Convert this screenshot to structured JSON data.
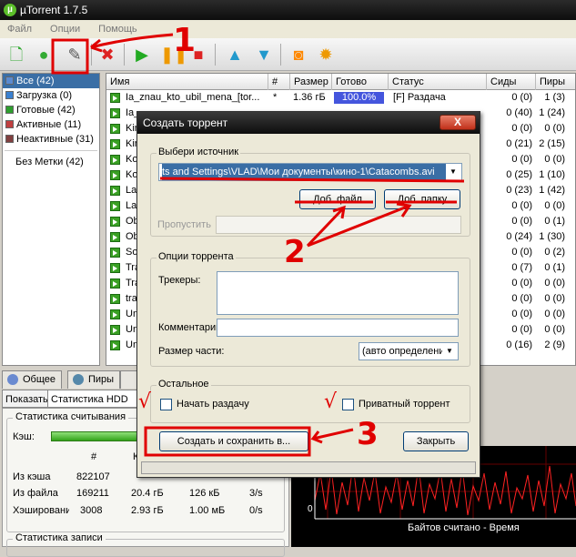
{
  "app": {
    "title": "µTorrent 1.7.5",
    "logo": "µ"
  },
  "menu": [
    "Файл",
    "Опции",
    "Помощь"
  ],
  "toolbar": [
    "add-torrent-icon",
    "add-url-icon",
    "create-torrent-icon",
    "remove-icon",
    "start-icon",
    "pause-icon",
    "stop-icon",
    "move-up-icon",
    "move-down-icon",
    "rss-icon",
    "settings-icon"
  ],
  "sidebar": {
    "items": [
      {
        "label": "Все (42)",
        "color": "#3a6ea5"
      },
      {
        "label": "Загрузка (0)",
        "color": "#3a80d0"
      },
      {
        "label": "Готовые (42)",
        "color": "#2e9e2e"
      },
      {
        "label": "Активные (11)",
        "color": "#c04040"
      },
      {
        "label": "Неактивные (31)",
        "color": "#804040"
      }
    ],
    "nolabel": "Без Метки (42)"
  },
  "list": {
    "columns": [
      "Имя",
      "#",
      "Размер",
      "Готово",
      "Статус",
      "Сиды",
      "Пиры"
    ],
    "first": {
      "name": "Ia_znau_kto_ubil_mena_[tor...",
      "num": "*",
      "size": "1.36 гБ",
      "done": "100.0%",
      "status": "[F] Раздача",
      "seeds": "0 (0)",
      "peers": "1 (3)"
    },
    "names": [
      "Ia_",
      "Kin",
      "Kin",
      "Kor",
      "Kor",
      "Lav",
      "Lav",
      "Ob",
      "Ob",
      "Sor",
      "Tra",
      "Tra",
      "tra",
      "Un",
      "Und",
      "Und"
    ],
    "seeds": [
      "0 (40)",
      "0 (0)",
      "0 (21)",
      "0 (0)",
      "0 (25)",
      "0 (23)",
      "0 (0)",
      "0 (0)",
      "0 (24)",
      "0 (0)",
      "0 (7)",
      "0 (0)",
      "0 (0)",
      "0 (0)",
      "0 (0)",
      "0 (16)"
    ],
    "peers": [
      "1 (24)",
      "0 (0)",
      "2 (15)",
      "0 (0)",
      "1 (10)",
      "1 (42)",
      "0 (0)",
      "0 (1)",
      "1 (30)",
      "0 (2)",
      "0 (1)",
      "0 (0)",
      "0 (0)",
      "0 (0)",
      "0 (0)",
      "2 (9)"
    ]
  },
  "bottom_tabs": [
    "Общее",
    "Пиры"
  ],
  "sub_tabs": [
    "Показать",
    "Статистика HDD"
  ],
  "stats": {
    "read_title": "Статистика считывания",
    "cache_label": "Кэш:",
    "col_hash": "#",
    "col_k": "К",
    "rows": [
      {
        "label": "Из кэша",
        "num": "822107"
      },
      {
        "label": "Из файла",
        "num": "169211",
        "size": "20.4 гБ",
        "rate": "126 кБ",
        "per": "3/s"
      },
      {
        "label": "Хэширование",
        "num": "3008",
        "size": "2.93 гБ",
        "rate": "1.00 мБ",
        "per": "0/s"
      }
    ],
    "write_title": "Статистика записи",
    "graph_zero": "0",
    "graph_caption": "Байтов считано - Время"
  },
  "dialog": {
    "title": "Создать торрент",
    "close": "X",
    "source_group": "Выбери источник",
    "source_path": "ts and Settings\\VLAD\\Мои документы\\кино-1\\Catacombs.avi",
    "add_file": "Доб. файл",
    "add_folder": "Доб. папку",
    "skip_label": "Пропустить",
    "options_group": "Опции торрента",
    "trackers_label": "Трекеры:",
    "comment_label": "Комментарий",
    "piece_label": "Размер части:",
    "piece_value": "(авто определение)",
    "other_group": "Остальное",
    "start_seed": "Начать раздачу",
    "private": "Приватный торрент",
    "create_save": "Создать и сохранить в...",
    "close_btn": "Закрыть"
  },
  "annotations": {
    "n1": "1",
    "n2": "2",
    "n3": "3",
    "check1": "√",
    "check2": "√"
  },
  "colors": {
    "accent": "#3a6ea5",
    "annotation": "#e00000",
    "progress": "#4455dd"
  }
}
